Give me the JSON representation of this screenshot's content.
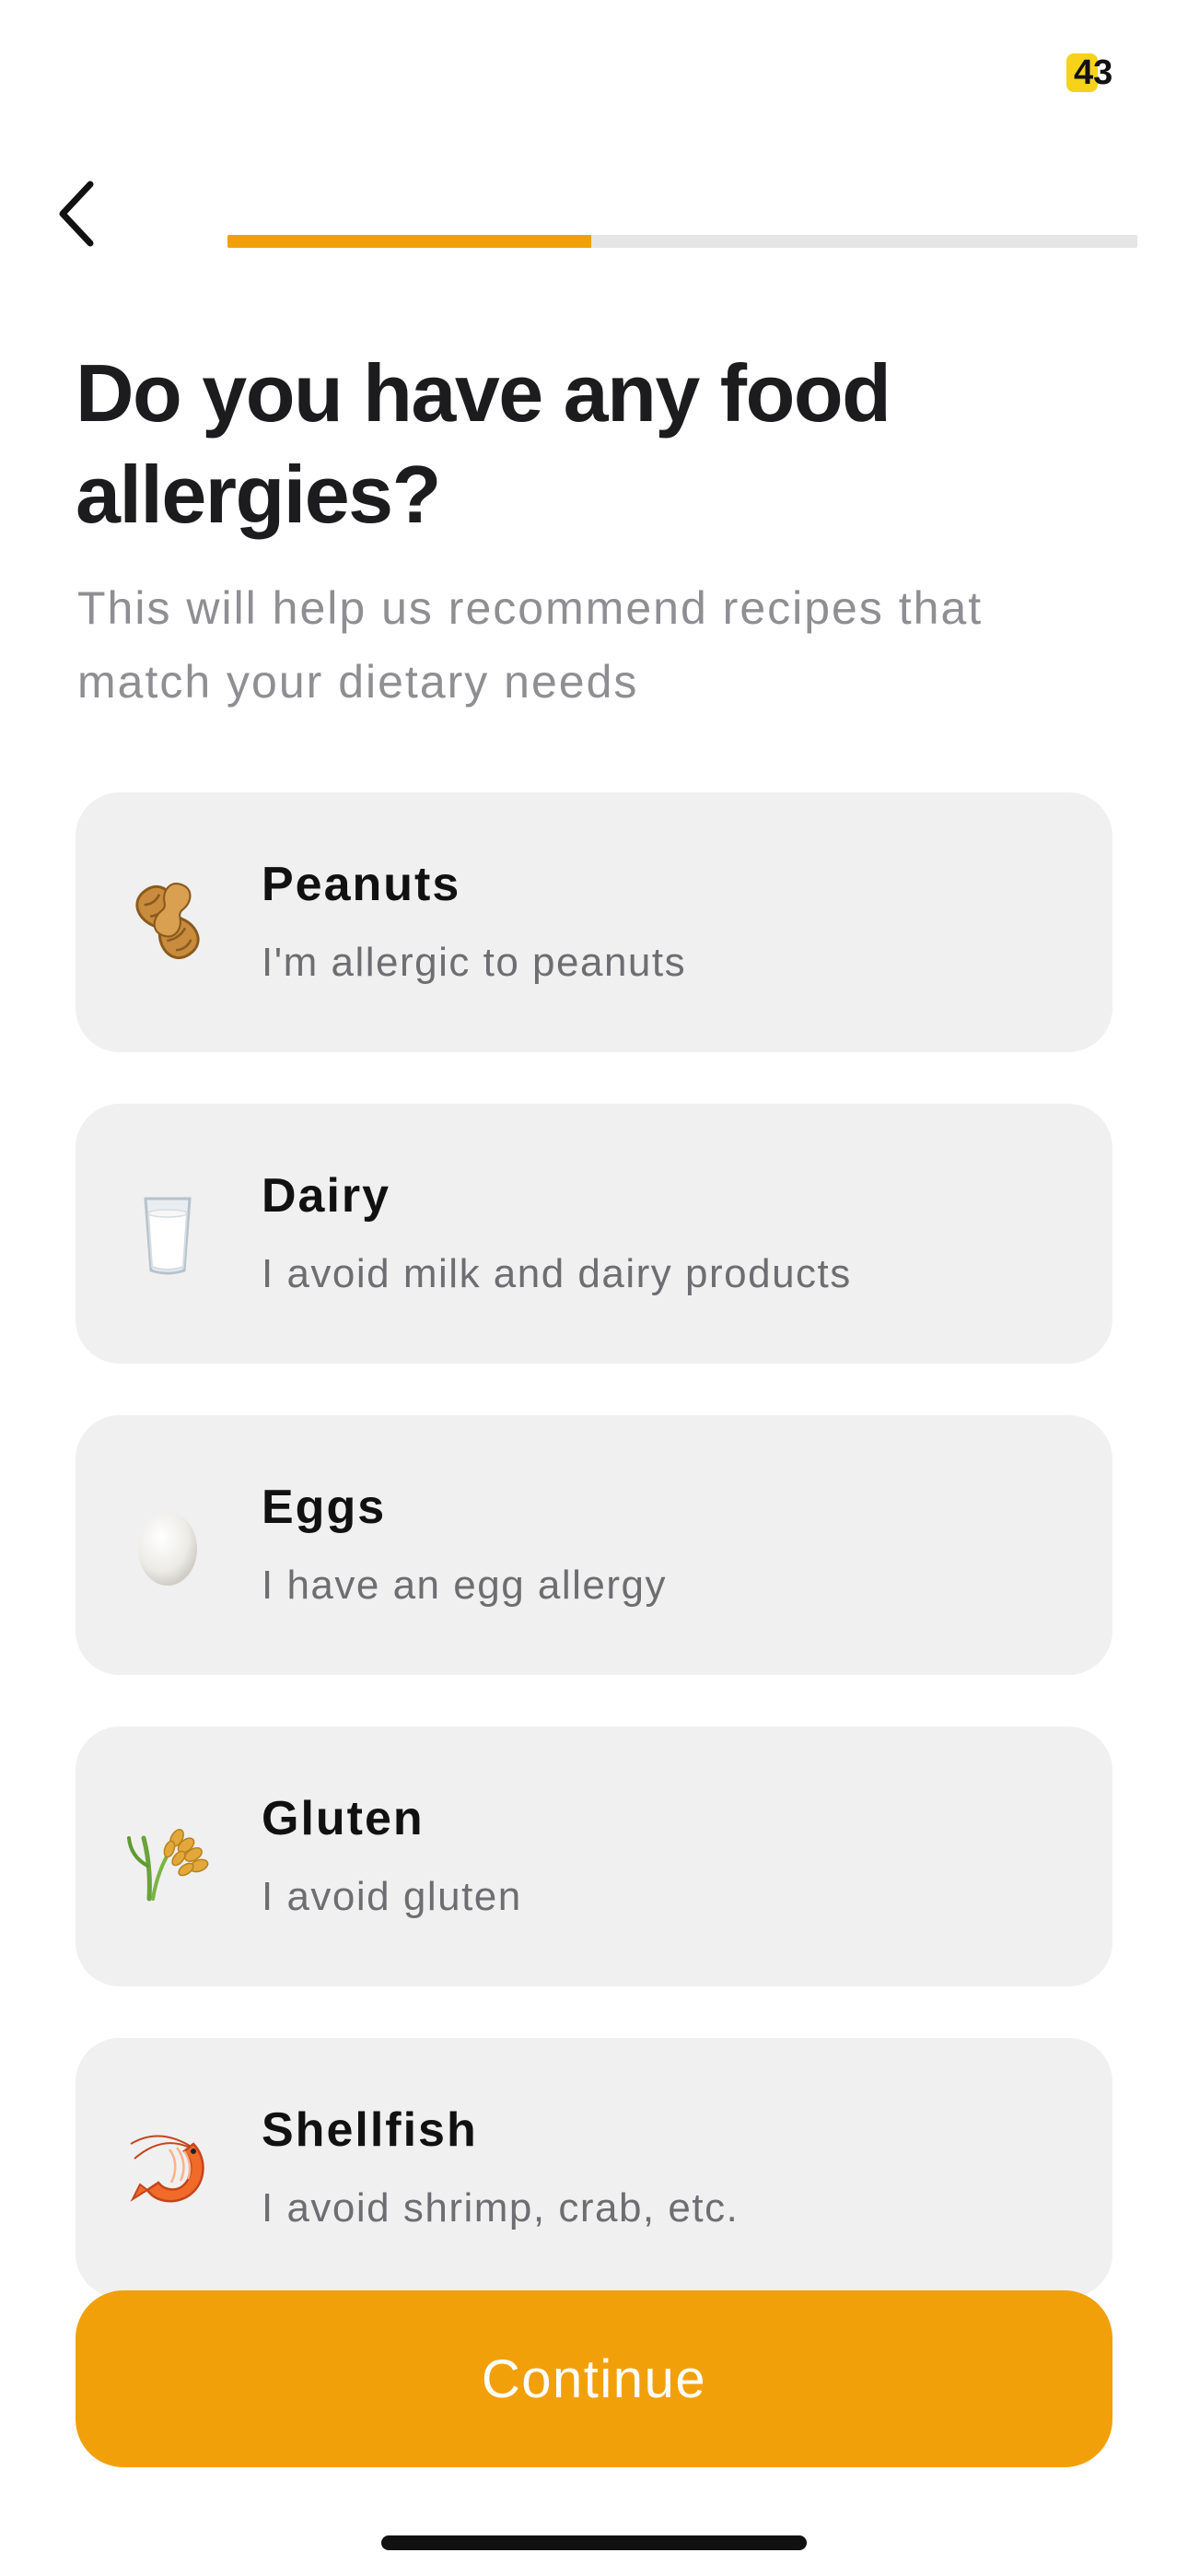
{
  "status_bar": {
    "battery_level": "43"
  },
  "progress": {
    "fraction": 0.4,
    "fill_color": "#f2a00a",
    "track_color": "#e5e5e5"
  },
  "header": {
    "back_icon": "chevron-left-icon",
    "title": "Do you have any food allergies?",
    "subtitle": "This will help us recommend recipes that match your dietary needs"
  },
  "options": [
    {
      "icon": "peanut-icon",
      "title": "Peanuts",
      "description": "I'm allergic to peanuts"
    },
    {
      "icon": "milk-glass-icon",
      "title": "Dairy",
      "description": "I avoid milk and dairy products"
    },
    {
      "icon": "egg-icon",
      "title": "Eggs",
      "description": "I have an egg allergy"
    },
    {
      "icon": "wheat-icon",
      "title": "Gluten",
      "description": "I avoid gluten"
    },
    {
      "icon": "shrimp-icon",
      "title": "Shellfish",
      "description": "I avoid shrimp, crab, etc."
    }
  ],
  "footer": {
    "continue_label": "Continue"
  },
  "colors": {
    "accent": "#f2a00a",
    "card_background": "#f0f0f0",
    "subtitle_text": "#8e8e93"
  }
}
